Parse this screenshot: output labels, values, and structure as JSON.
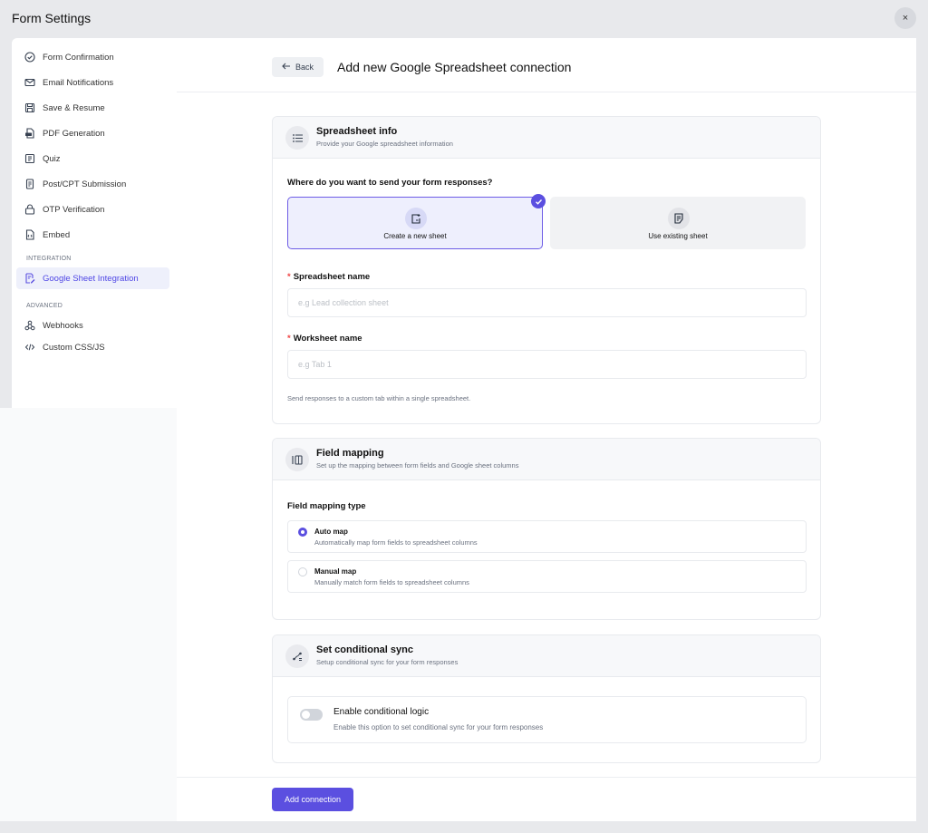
{
  "window": {
    "title": "Form Settings",
    "close_icon": "×"
  },
  "sidebar": {
    "items": [
      {
        "label": "Form Confirmation",
        "icon": "check-circle-icon"
      },
      {
        "label": "Email Notifications",
        "icon": "mail-icon"
      },
      {
        "label": "Save & Resume",
        "icon": "save-icon"
      },
      {
        "label": "PDF Generation",
        "icon": "pdf-icon"
      },
      {
        "label": "Quiz",
        "icon": "quiz-icon"
      },
      {
        "label": "Post/CPT Submission",
        "icon": "document-icon"
      },
      {
        "label": "OTP Verification",
        "icon": "lock-icon"
      },
      {
        "label": "Embed",
        "icon": "code-file-icon"
      }
    ],
    "section_integration": "INTEGRATION",
    "integration_items": [
      {
        "label": "Google Sheet Integration",
        "icon": "sheet-edit-icon",
        "active": true
      }
    ],
    "section_advanced": "ADVANCED",
    "advanced_items": [
      {
        "label": "Webhooks",
        "icon": "webhook-icon"
      },
      {
        "label": "Custom CSS/JS",
        "icon": "code-icon"
      }
    ]
  },
  "header": {
    "back_label": "Back",
    "title": "Add new Google Spreadsheet connection"
  },
  "spreadsheet_info": {
    "title": "Spreadsheet info",
    "subtitle": "Provide your Google spreadsheet information",
    "question": "Where do you want to send your form responses?",
    "options": [
      {
        "label": "Create a new sheet",
        "selected": true
      },
      {
        "label": "Use existing sheet",
        "selected": false
      }
    ],
    "spreadsheet_name_label": "Spreadsheet name",
    "spreadsheet_name_placeholder": "e.g Lead collection sheet",
    "worksheet_name_label": "Worksheet name",
    "worksheet_name_placeholder": "e.g Tab 1",
    "worksheet_helper": "Send responses to a custom tab within a single spreadsheet.",
    "required_mark": "*"
  },
  "field_mapping": {
    "title": "Field mapping",
    "subtitle": "Set up the mapping between form fields and Google sheet columns",
    "type_label": "Field mapping type",
    "options": [
      {
        "label": "Auto map",
        "description": "Automatically map form fields to spreadsheet columns",
        "selected": true
      },
      {
        "label": "Manual map",
        "description": "Manually match form fields to spreadsheet columns",
        "selected": false
      }
    ]
  },
  "conditional_sync": {
    "title": "Set conditional sync",
    "subtitle": "Setup conditional sync for your form responses",
    "toggle_label": "Enable conditional logic",
    "toggle_description": "Enable this option to set conditional sync for your form responses",
    "enabled": false
  },
  "footer": {
    "add_button": "Add connection"
  },
  "colors": {
    "accent": "#5b4fe0",
    "active_bg": "#eef0fb",
    "required": "#ef4444"
  }
}
